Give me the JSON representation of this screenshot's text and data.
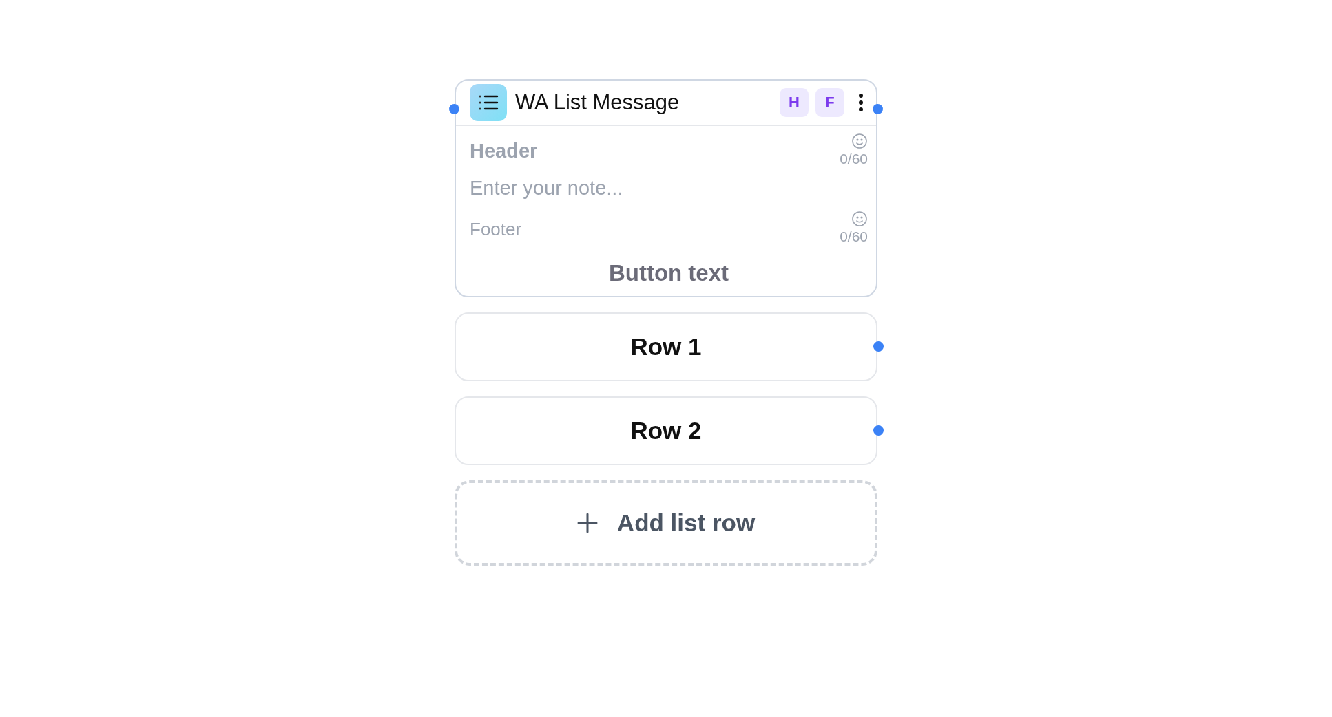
{
  "node": {
    "title": "WA List Message",
    "badges": [
      {
        "label": "H"
      },
      {
        "label": "F"
      }
    ],
    "header": {
      "placeholder": "Header",
      "counter": "0/60"
    },
    "note": {
      "placeholder": "Enter your note..."
    },
    "footer": {
      "placeholder": "Footer",
      "counter": "0/60"
    },
    "button_text": {
      "placeholder": "Button text"
    }
  },
  "rows": [
    {
      "label": "Row 1"
    },
    {
      "label": "Row 2"
    }
  ],
  "add_row": {
    "label": "Add list row"
  }
}
